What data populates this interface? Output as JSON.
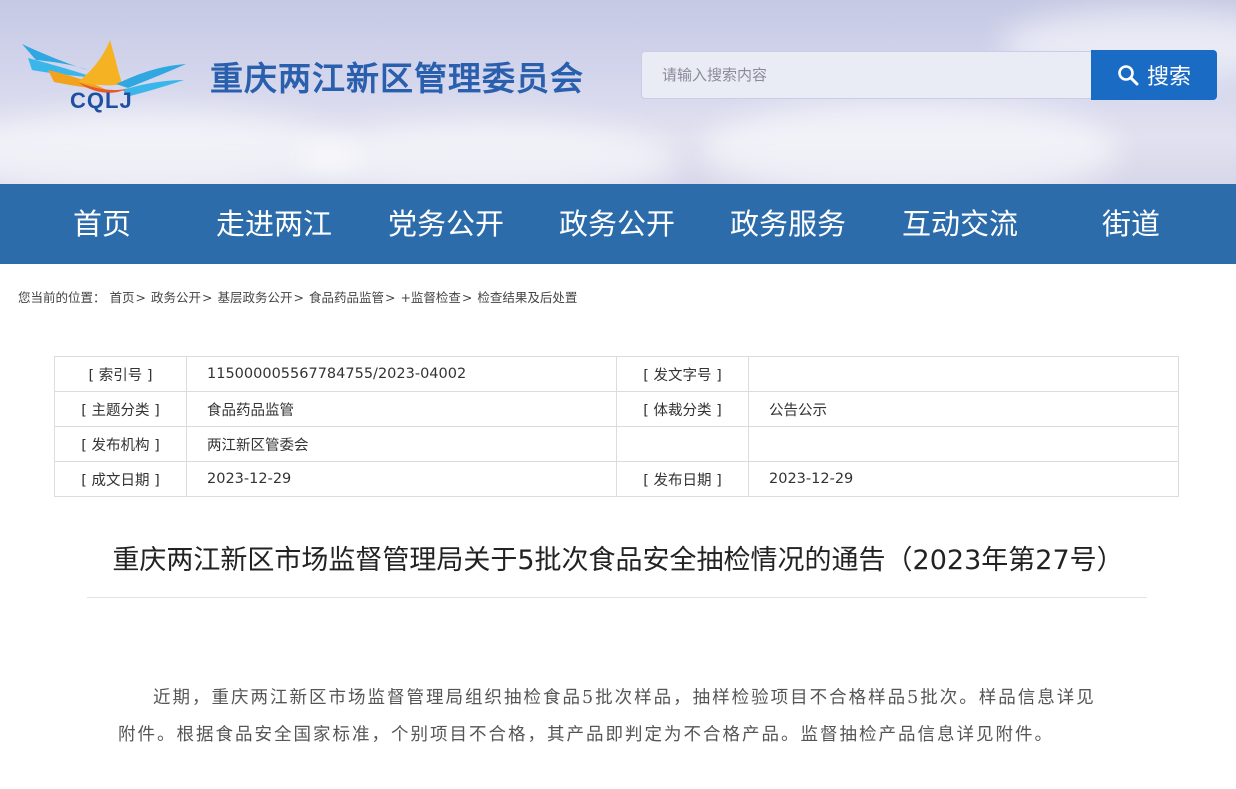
{
  "header": {
    "logo_text": "CQLJ",
    "site_title": "重庆两江新区管理委员会",
    "search_placeholder": "请输入搜索内容",
    "search_label": "搜索"
  },
  "nav": {
    "items": [
      "首页",
      "走进两江",
      "党务公开",
      "政务公开",
      "政务服务",
      "互动交流",
      "街道"
    ]
  },
  "breadcrumb": {
    "prefix": "您当前的位置：",
    "items": [
      "首页",
      "政务公开",
      "基层政务公开",
      "食品药品监管",
      "+监督检查",
      "检查结果及后处置"
    ]
  },
  "meta": {
    "rows": [
      {
        "k1": "[ 索引号 ]",
        "v1": "115000005567784755/2023-04002",
        "k2": "[ 发文字号 ]",
        "v2": ""
      },
      {
        "k1": "[ 主题分类 ]",
        "v1": "食品药品监管",
        "k2": "[ 体裁分类 ]",
        "v2": "公告公示"
      },
      {
        "k1": "[ 发布机构 ]",
        "v1": "两江新区管委会",
        "k2": "",
        "v2": ""
      },
      {
        "k1": "[ 成文日期 ]",
        "v1": "2023-12-29",
        "k2": "[ 发布日期 ]",
        "v2": "2023-12-29"
      }
    ]
  },
  "article": {
    "title": "重庆两江新区市场监督管理局关于5批次食品安全抽检情况的通告（2023年第27号）",
    "body": "近期，重庆两江新区市场监督管理局组织抽检食品5批次样品，抽样检验项目不合格样品5批次。样品信息详见附件。根据食品安全国家标准，个别项目不合格，其产品即判定为不合格产品。监督抽检产品信息详见附件。"
  },
  "colors": {
    "nav_bg": "#2c6cab",
    "search_button": "#1a6bc4",
    "title_blue": "#2a5fae"
  },
  "icons": {
    "search": "search-icon",
    "logo": "cqlj-logo"
  }
}
